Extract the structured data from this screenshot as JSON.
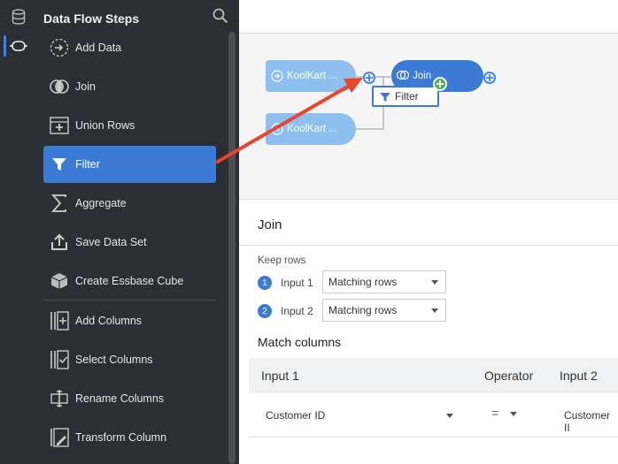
{
  "panel": {
    "title": "Data Flow Steps",
    "steps": [
      {
        "label": "Add Data",
        "icon": "add-data-icon"
      },
      {
        "label": "Join",
        "icon": "join-icon"
      },
      {
        "label": "Union Rows",
        "icon": "union-rows-icon"
      },
      {
        "label": "Filter",
        "icon": "filter-icon",
        "selected": true
      },
      {
        "label": "Aggregate",
        "icon": "sigma-icon"
      },
      {
        "label": "Save Data Set",
        "icon": "upload-icon"
      },
      {
        "label": "Create Essbase Cube",
        "icon": "cube-icon"
      },
      {
        "label": "Add Columns",
        "icon": "add-columns-icon"
      },
      {
        "label": "Select Columns",
        "icon": "select-columns-icon"
      },
      {
        "label": "Rename Columns",
        "icon": "rename-columns-icon"
      },
      {
        "label": "Transform Column",
        "icon": "transform-column-icon"
      }
    ]
  },
  "canvas": {
    "source1": "KoolKart ...",
    "source2": "KoolKart ...",
    "join_node": "Join",
    "drag_chip": "Filter"
  },
  "join": {
    "title": "Join",
    "keep_rows": "Keep rows",
    "input1": {
      "num": "1",
      "label": "Input 1",
      "value": "Matching rows"
    },
    "input2": {
      "num": "2",
      "label": "Input 2",
      "value": "Matching rows"
    },
    "match_columns": "Match columns",
    "table": {
      "headers": [
        "Input 1",
        "Operator",
        "Input 2"
      ],
      "row": {
        "input1": "Customer ID",
        "operator": "=",
        "input2": "Customer II"
      }
    }
  },
  "colors": {
    "accent": "#3b7bd6",
    "panel_bg": "#2b2e32",
    "arrow": "#e8452c",
    "source_node": "#8dc0ee",
    "plus_green": "#4caf50"
  }
}
